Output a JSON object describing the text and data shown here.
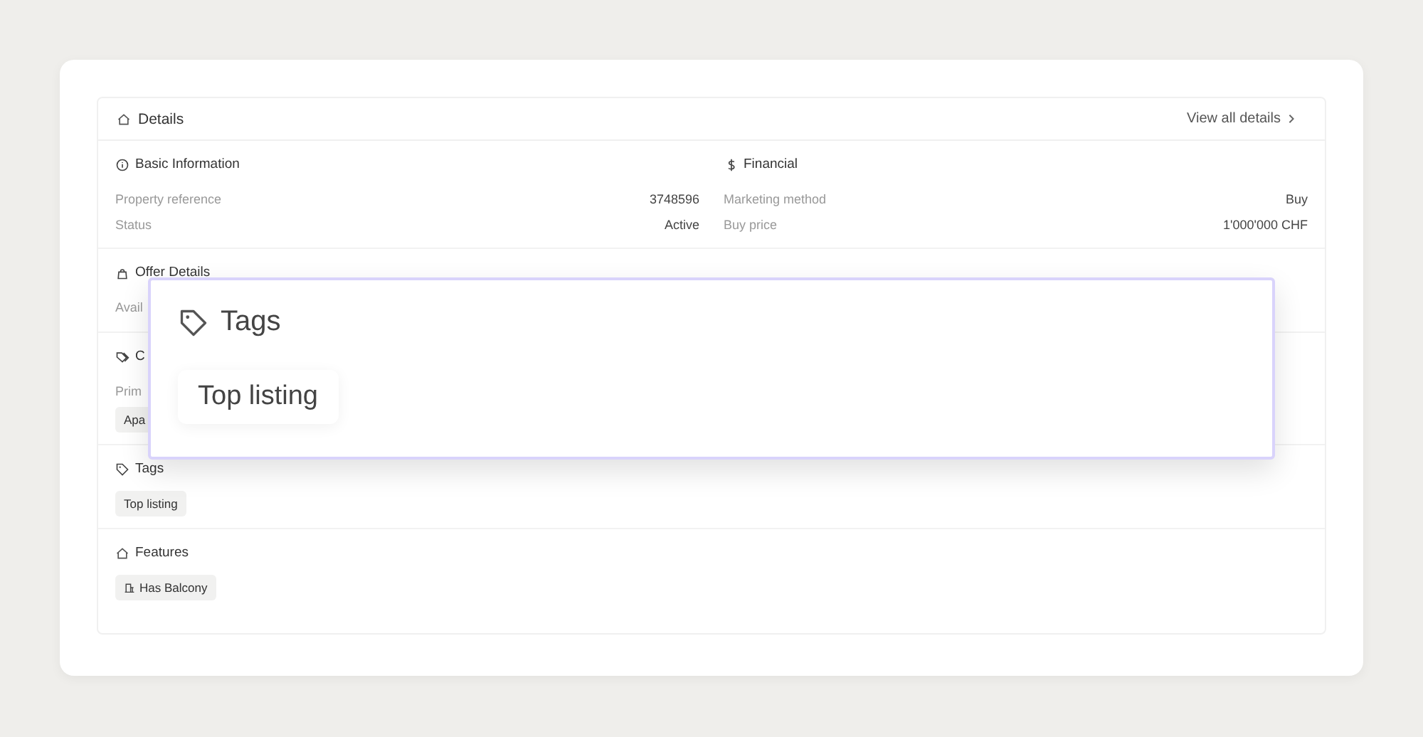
{
  "details": {
    "title": "Details",
    "view_all": "View all details"
  },
  "top_sections": [
    {
      "kind": "info",
      "title": "Basic Information",
      "rows": [
        {
          "label": "Property reference",
          "value": "3748596"
        },
        {
          "label": "Status",
          "value": "Active"
        }
      ]
    },
    {
      "kind": "financial",
      "title": "Financial",
      "rows": [
        {
          "label": "Marketing method",
          "value": "Buy"
        },
        {
          "label": "Buy price",
          "value": "1'000'000 CHF"
        }
      ]
    }
  ],
  "sections": [
    {
      "kind": "offer",
      "title": "Offer Details",
      "rows": [
        {
          "label": "Avail"
        }
      ]
    },
    {
      "kind": "category",
      "title": "C",
      "rows": [
        {
          "label": "Prim"
        }
      ],
      "chips": [
        {
          "label": "Apa",
          "kind": "plain"
        }
      ]
    },
    {
      "kind": "tags",
      "title": "Tags",
      "chips": [
        {
          "label": "Top listing",
          "kind": "plain"
        }
      ]
    },
    {
      "kind": "features",
      "title": "Features",
      "chips": [
        {
          "label": "Has Balcony",
          "kind": "feature"
        }
      ]
    }
  ],
  "popover": {
    "title": "Tags",
    "chips": [
      "Top listing"
    ]
  }
}
